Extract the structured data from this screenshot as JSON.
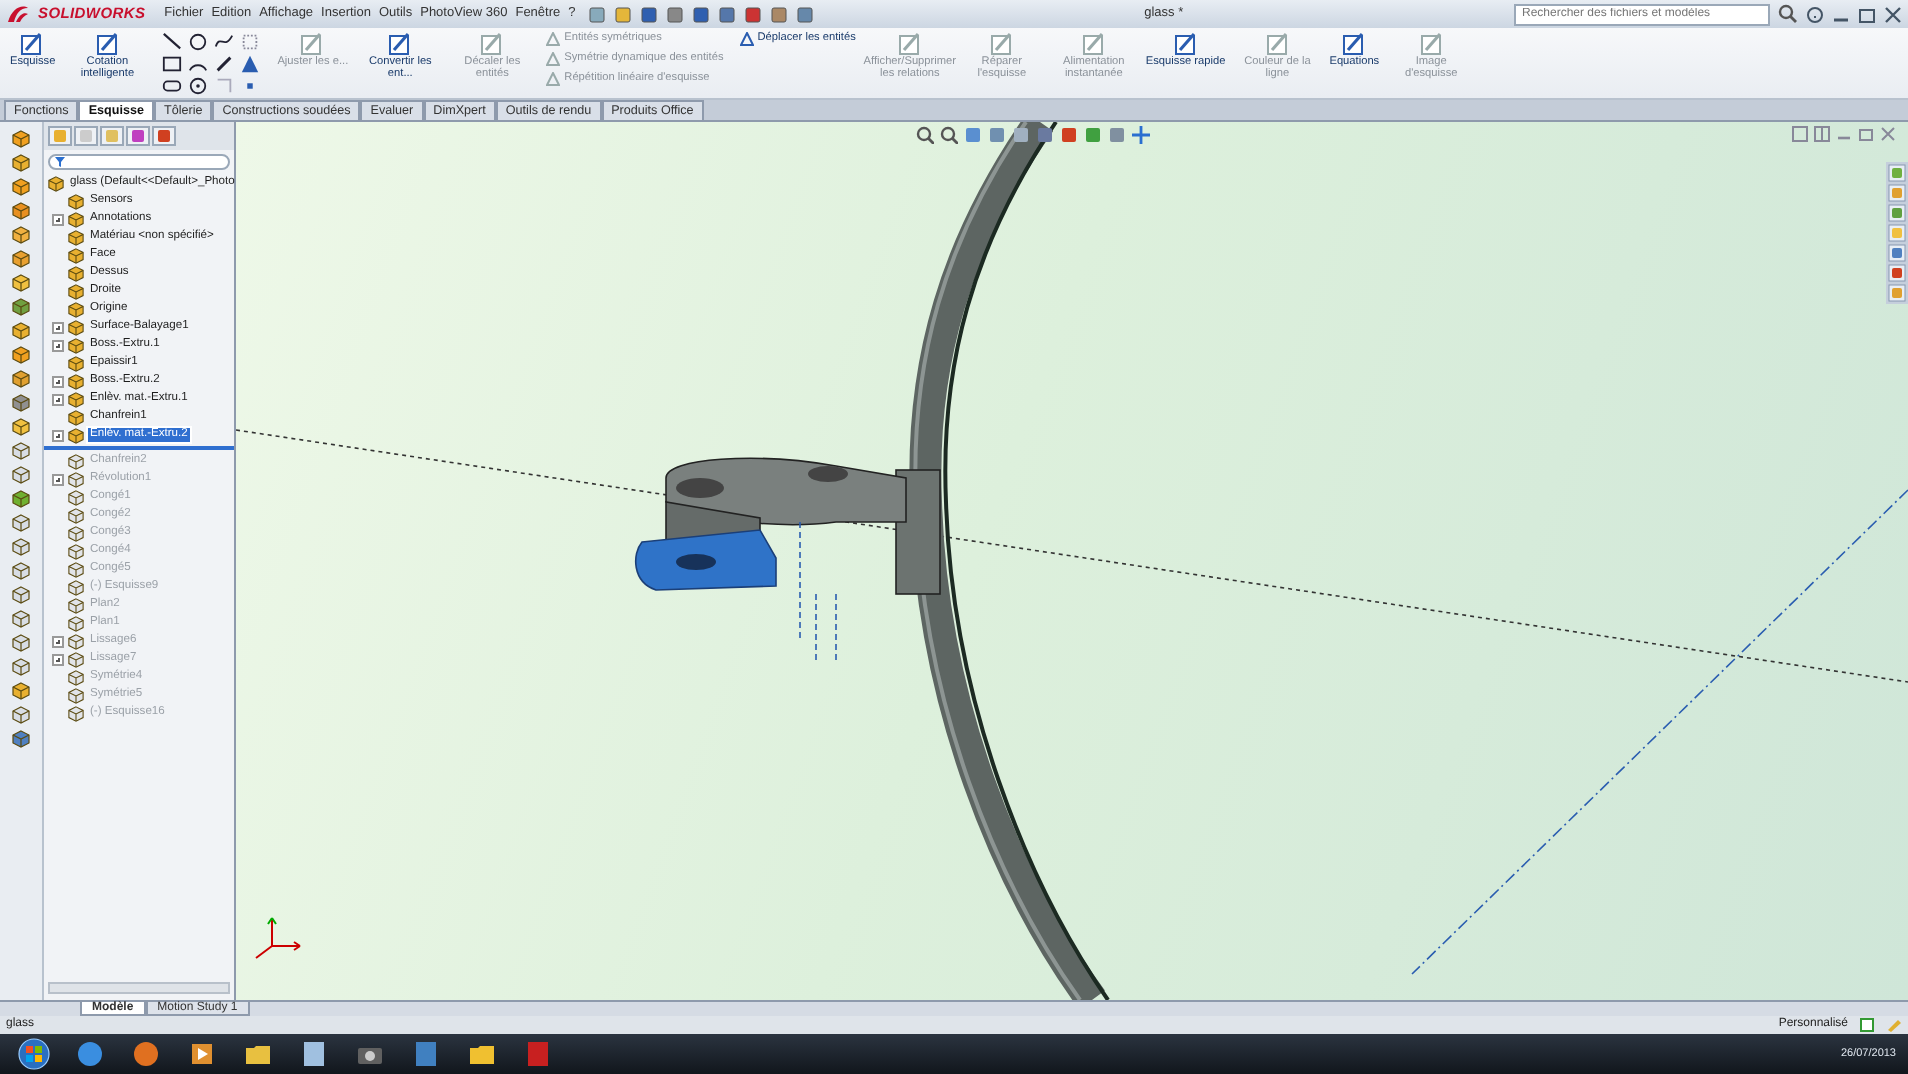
{
  "app": {
    "logo_text": "SOLIDWORKS"
  },
  "menu": [
    "Fichier",
    "Edition",
    "Affichage",
    "Insertion",
    "Outils",
    "PhotoView 360",
    "Fenêtre",
    "?"
  ],
  "window": {
    "title": "glass *"
  },
  "search": {
    "placeholder": "Rechercher des fichiers et modèles"
  },
  "ribbon": [
    {
      "kind": "large",
      "label": "Esquisse",
      "disabled": false
    },
    {
      "kind": "large",
      "label": "Cotation intelligente",
      "disabled": false
    },
    {
      "kind": "tools"
    },
    {
      "kind": "large",
      "label": "Ajuster les e...",
      "disabled": true
    },
    {
      "kind": "large",
      "label": "Convertir les ent...",
      "disabled": false
    },
    {
      "kind": "large",
      "label": "Décaler les entités",
      "disabled": true
    },
    {
      "kind": "stack",
      "label": "Entités symétriques",
      "disabled": true
    },
    {
      "kind": "stack",
      "label": "Symétrie dynamique des entités",
      "disabled": true
    },
    {
      "kind": "stack",
      "label": "Répétition linéaire d'esquisse",
      "disabled": true
    },
    {
      "kind": "stack",
      "label": "Déplacer les entités",
      "disabled": false
    },
    {
      "kind": "large",
      "label": "Afficher/Supprimer les relations",
      "disabled": true
    },
    {
      "kind": "large",
      "label": "Réparer l'esquisse",
      "disabled": true
    },
    {
      "kind": "large",
      "label": "Alimentation instantanée",
      "disabled": true
    },
    {
      "kind": "large",
      "label": "Esquisse rapide",
      "disabled": false
    },
    {
      "kind": "large",
      "label": "Couleur de la ligne",
      "disabled": true
    },
    {
      "kind": "large",
      "label": "Equations",
      "disabled": false
    },
    {
      "kind": "large",
      "label": "Image d'esquisse",
      "disabled": true
    }
  ],
  "command_tabs": [
    {
      "label": "Fonctions",
      "selected": false
    },
    {
      "label": "Esquisse",
      "selected": true
    },
    {
      "label": "Tôlerie",
      "selected": false
    },
    {
      "label": "Constructions soudées",
      "selected": false
    },
    {
      "label": "Evaluer",
      "selected": false
    },
    {
      "label": "DimXpert",
      "selected": false
    },
    {
      "label": "Outils de rendu",
      "selected": false
    },
    {
      "label": "Produits Office",
      "selected": false
    }
  ],
  "feature_tree": {
    "root": "glass  (Default<<Default>_Photo",
    "items": [
      {
        "label": "Sensors",
        "expandable": false,
        "suppressed": false,
        "selected": false
      },
      {
        "label": "Annotations",
        "expandable": true,
        "suppressed": false,
        "selected": false
      },
      {
        "label": "Matériau <non spécifié>",
        "expandable": false,
        "suppressed": false,
        "selected": false
      },
      {
        "label": "Face",
        "expandable": false,
        "suppressed": false,
        "selected": false
      },
      {
        "label": "Dessus",
        "expandable": false,
        "suppressed": false,
        "selected": false
      },
      {
        "label": "Droite",
        "expandable": false,
        "suppressed": false,
        "selected": false
      },
      {
        "label": "Origine",
        "expandable": false,
        "suppressed": false,
        "selected": false
      },
      {
        "label": "Surface-Balayage1",
        "expandable": true,
        "suppressed": false,
        "selected": false
      },
      {
        "label": "Boss.-Extru.1",
        "expandable": true,
        "suppressed": false,
        "selected": false
      },
      {
        "label": "Epaissir1",
        "expandable": false,
        "suppressed": false,
        "selected": false
      },
      {
        "label": "Boss.-Extru.2",
        "expandable": true,
        "suppressed": false,
        "selected": false
      },
      {
        "label": "Enlèv. mat.-Extru.1",
        "expandable": true,
        "suppressed": false,
        "selected": false
      },
      {
        "label": "Chanfrein1",
        "expandable": false,
        "suppressed": false,
        "selected": false
      },
      {
        "label": "Enlèv. mat.-Extru.2",
        "expandable": true,
        "suppressed": false,
        "selected": true
      },
      {
        "label": "Chanfrein2",
        "expandable": false,
        "suppressed": true,
        "selected": false
      },
      {
        "label": "Révolution1",
        "expandable": true,
        "suppressed": true,
        "selected": false
      },
      {
        "label": "Congé1",
        "expandable": false,
        "suppressed": true,
        "selected": false
      },
      {
        "label": "Congé2",
        "expandable": false,
        "suppressed": true,
        "selected": false
      },
      {
        "label": "Congé3",
        "expandable": false,
        "suppressed": true,
        "selected": false
      },
      {
        "label": "Congé4",
        "expandable": false,
        "suppressed": true,
        "selected": false
      },
      {
        "label": "Congé5",
        "expandable": false,
        "suppressed": true,
        "selected": false
      },
      {
        "label": "(-) Esquisse9",
        "expandable": false,
        "suppressed": true,
        "selected": false
      },
      {
        "label": "Plan2",
        "expandable": false,
        "suppressed": true,
        "selected": false
      },
      {
        "label": "Plan1",
        "expandable": false,
        "suppressed": true,
        "selected": false
      },
      {
        "label": "Lissage6",
        "expandable": true,
        "suppressed": true,
        "selected": false
      },
      {
        "label": "Lissage7",
        "expandable": true,
        "suppressed": true,
        "selected": false
      },
      {
        "label": "Symétrie4",
        "expandable": false,
        "suppressed": true,
        "selected": false
      },
      {
        "label": "Symétrie5",
        "expandable": false,
        "suppressed": true,
        "selected": false
      },
      {
        "label": "(-) Esquisse16",
        "expandable": false,
        "suppressed": true,
        "selected": false
      }
    ]
  },
  "bottom_tabs": [
    {
      "label": "Modèle",
      "selected": true
    },
    {
      "label": "Motion Study 1",
      "selected": false
    }
  ],
  "status_bar": {
    "document": "glass",
    "config": "Personnalisé"
  },
  "taskbar": {
    "date": "26/07/2013"
  }
}
